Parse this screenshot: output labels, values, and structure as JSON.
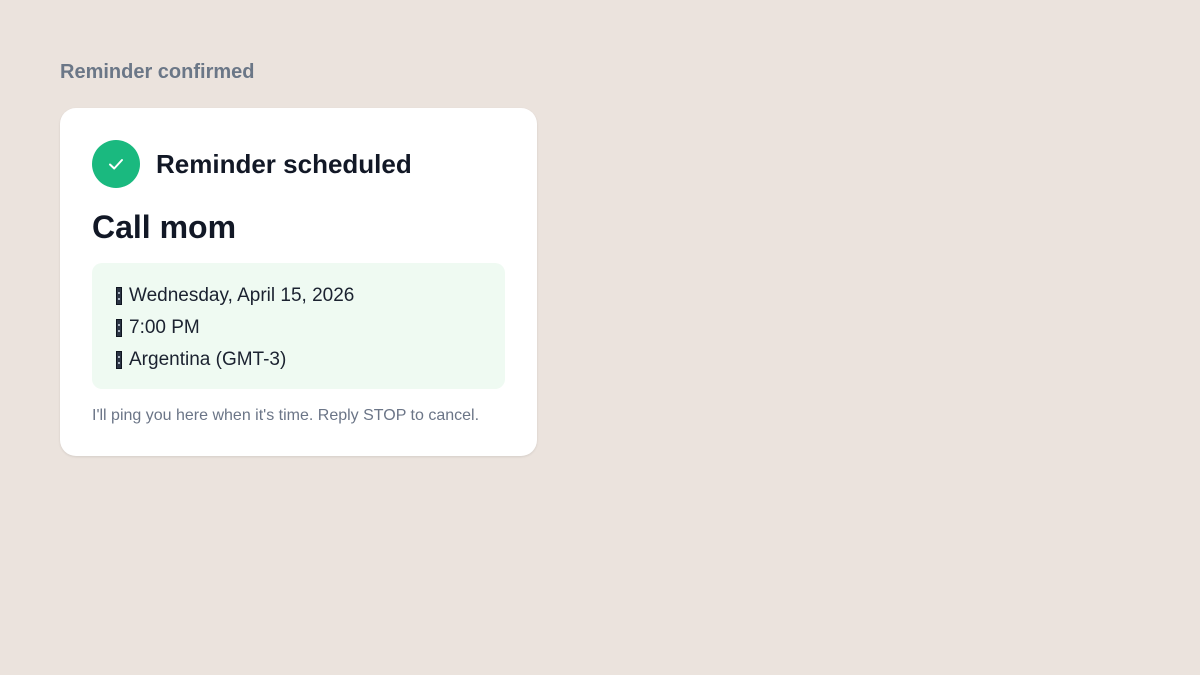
{
  "page": {
    "heading": "Reminder confirmed"
  },
  "card": {
    "status_icon": "checkmark-icon",
    "status_title": "Reminder scheduled",
    "reminder_title": "Call mom",
    "details": [
      {
        "icon": "calendar-icon",
        "text": "Wednesday, April 15, 2026"
      },
      {
        "icon": "clock-icon",
        "text": "7:00 PM"
      },
      {
        "icon": "globe-icon",
        "text": "Argentina (GMT-3)"
      }
    ],
    "footnote": "I'll ping you here when it's time. Reply STOP to cancel."
  },
  "colors": {
    "background": "#ebe3dd",
    "accent_green": "#1ab97f",
    "details_background": "#effaf2",
    "heading_text": "#6b7787",
    "primary_text": "#121826"
  }
}
